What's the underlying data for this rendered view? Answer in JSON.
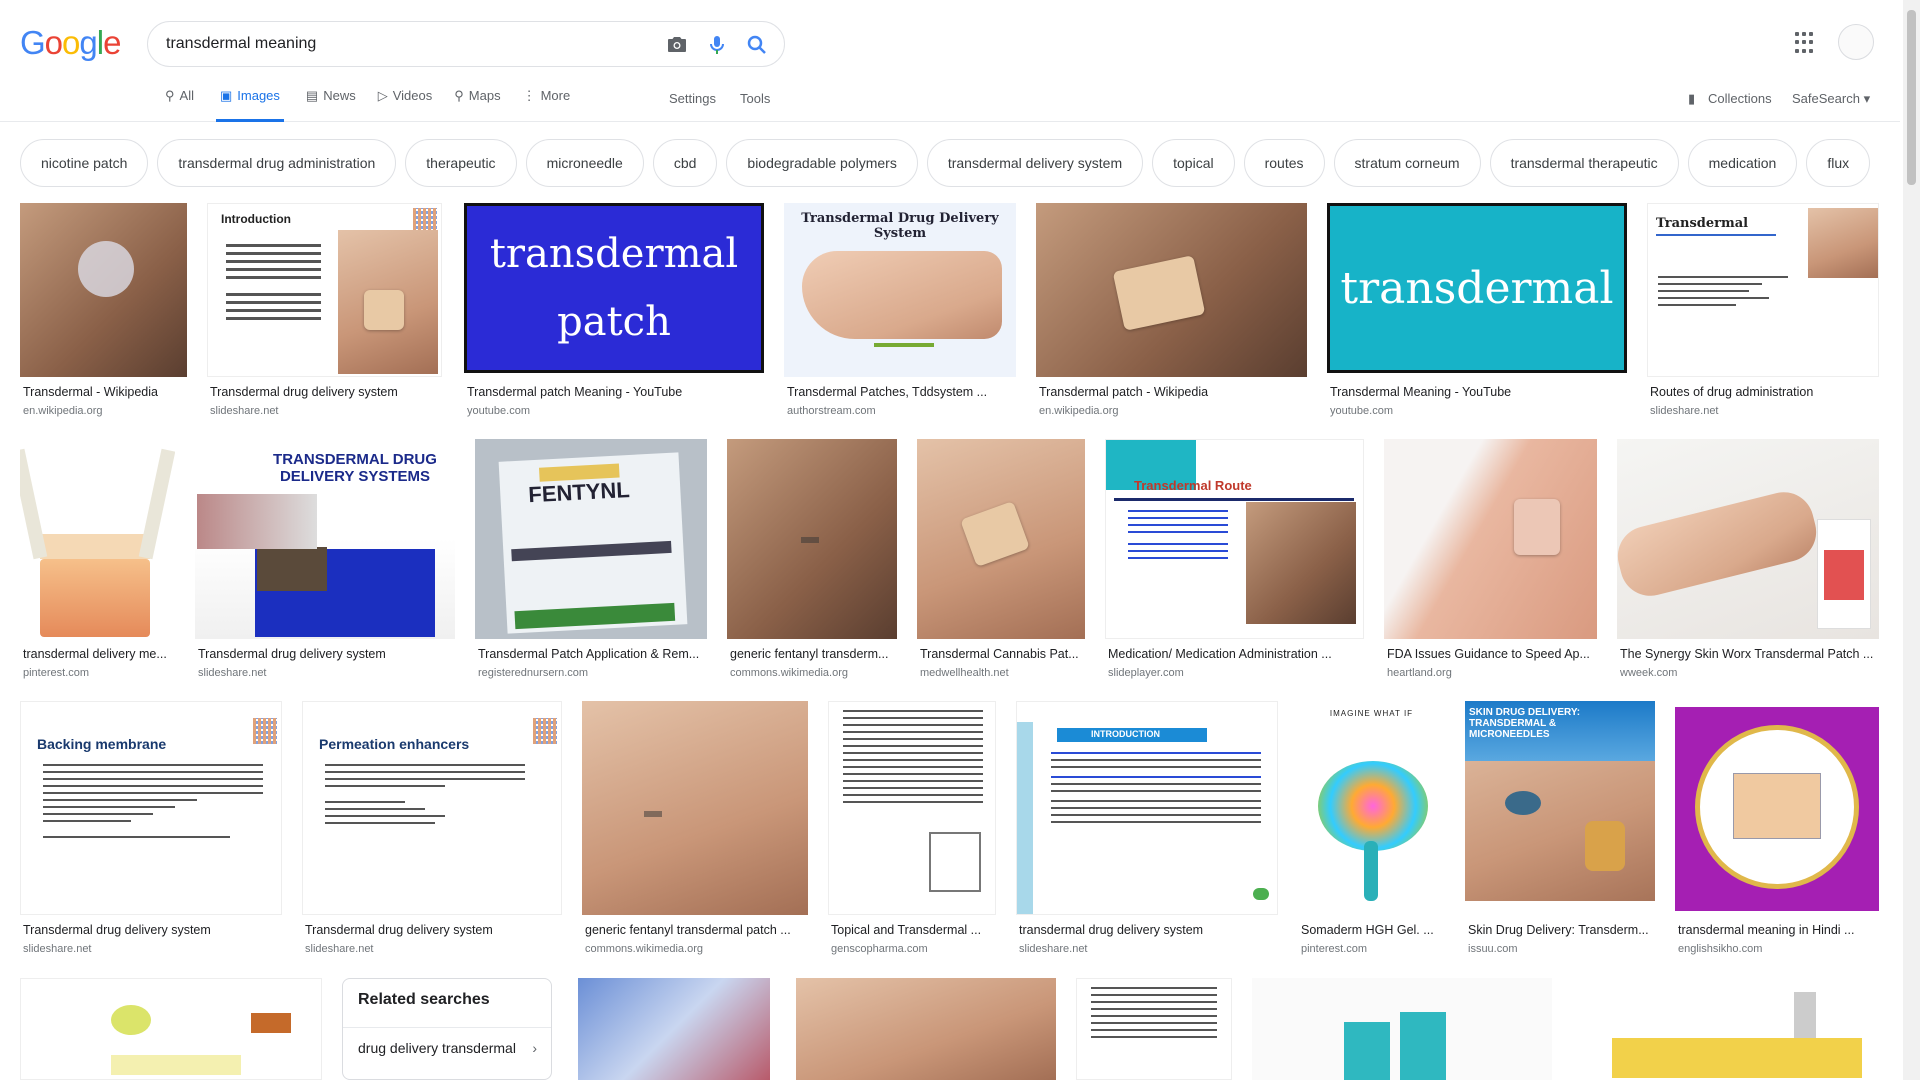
{
  "header": {
    "logo": "Google",
    "search_value": "transdermal meaning",
    "icons": [
      "camera-icon",
      "mic-icon",
      "search-icon",
      "apps-icon",
      "avatar"
    ]
  },
  "tabs": [
    {
      "label": "All",
      "icon": "search-icon"
    },
    {
      "label": "Images",
      "icon": "image-icon",
      "active": true
    },
    {
      "label": "News",
      "icon": "news-icon"
    },
    {
      "label": "Videos",
      "icon": "video-icon"
    },
    {
      "label": "Maps",
      "icon": "map-icon"
    },
    {
      "label": "More",
      "icon": "more-icon"
    }
  ],
  "tools": {
    "settings": "Settings",
    "tools": "Tools",
    "collections": "Collections",
    "safesearch": "SafeSearch"
  },
  "chips": [
    "nicotine patch",
    "transdermal drug administration",
    "therapeutic",
    "microneedle",
    "cbd",
    "biodegradable polymers",
    "transdermal delivery system",
    "topical",
    "routes",
    "stratum corneum",
    "transdermal therapeutic",
    "medication",
    "flux"
  ],
  "results": [
    {
      "caption": "Transdermal - Wikipedia",
      "source": "en.wikipedia.org"
    },
    {
      "caption": "Transdermal drug delivery system",
      "source": "slideshare.net",
      "slide_title": "Introduction"
    },
    {
      "caption": "Transdermal patch Meaning - YouTube",
      "source": "youtube.com",
      "line1": "transdermal",
      "line2": "patch"
    },
    {
      "caption": "Transdermal Patches, Tddsystem ...",
      "source": "authorstream.com",
      "slide_title": "Transdermal Drug Delivery System"
    },
    {
      "caption": "Transdermal patch - Wikipedia",
      "source": "en.wikipedia.org"
    },
    {
      "caption": "Transdermal Meaning - YouTube",
      "source": "youtube.com",
      "line1": "transdermal"
    },
    {
      "caption": "Routes of drug administration",
      "source": "slideshare.net",
      "slide_title": "Transdermal"
    },
    {
      "caption": "transdermal delivery me...",
      "source": "pinterest.com"
    },
    {
      "caption": "Transdermal drug delivery system",
      "source": "slideshare.net",
      "slide_title": "TRANSDERMAL DRUG DELIVERY SYSTEMS"
    },
    {
      "caption": "Transdermal Patch Application & Rem...",
      "source": "registerednursern.com",
      "slide_title": "FENTYNL"
    },
    {
      "caption": "generic fentanyl transderm...",
      "source": "commons.wikimedia.org"
    },
    {
      "caption": "Transdermal Cannabis Pat...",
      "source": "medwellhealth.net"
    },
    {
      "caption": "Medication/ Medication Administration ...",
      "source": "slideplayer.com",
      "slide_title": "Transdermal Route"
    },
    {
      "caption": "FDA Issues Guidance to Speed Ap...",
      "source": "heartland.org"
    },
    {
      "caption": "The Synergy Skin Worx Transdermal Patch ...",
      "source": "wweek.com"
    },
    {
      "caption": "Transdermal drug delivery system",
      "source": "slideshare.net",
      "slide_title": "Backing membrane"
    },
    {
      "caption": "Transdermal drug delivery system",
      "source": "slideshare.net",
      "slide_title": "Permeation enhancers"
    },
    {
      "caption": "generic fentanyl transdermal patch ...",
      "source": "commons.wikimedia.org"
    },
    {
      "caption": "Topical and Transdermal ...",
      "source": "genscopharma.com"
    },
    {
      "caption": "transdermal drug delivery system",
      "source": "slideshare.net",
      "slide_title": "INTRODUCTION"
    },
    {
      "caption": "Somaderm HGH Gel. ...",
      "source": "pinterest.com",
      "slide_title": "IMAGINE WHAT IF"
    },
    {
      "caption": "Skin Drug Delivery: Transderm...",
      "source": "issuu.com",
      "slide_title": "SKIN DRUG DELIVERY: TRANSDERMAL & MICRONEEDLES"
    },
    {
      "caption": "transdermal meaning in Hindi ...",
      "source": "englishsikho.com"
    }
  ],
  "related": {
    "title": "Related searches",
    "item": "drug delivery transdermal"
  },
  "colors": {
    "accent": "#1a73e8",
    "border": "#dfe1e5"
  }
}
